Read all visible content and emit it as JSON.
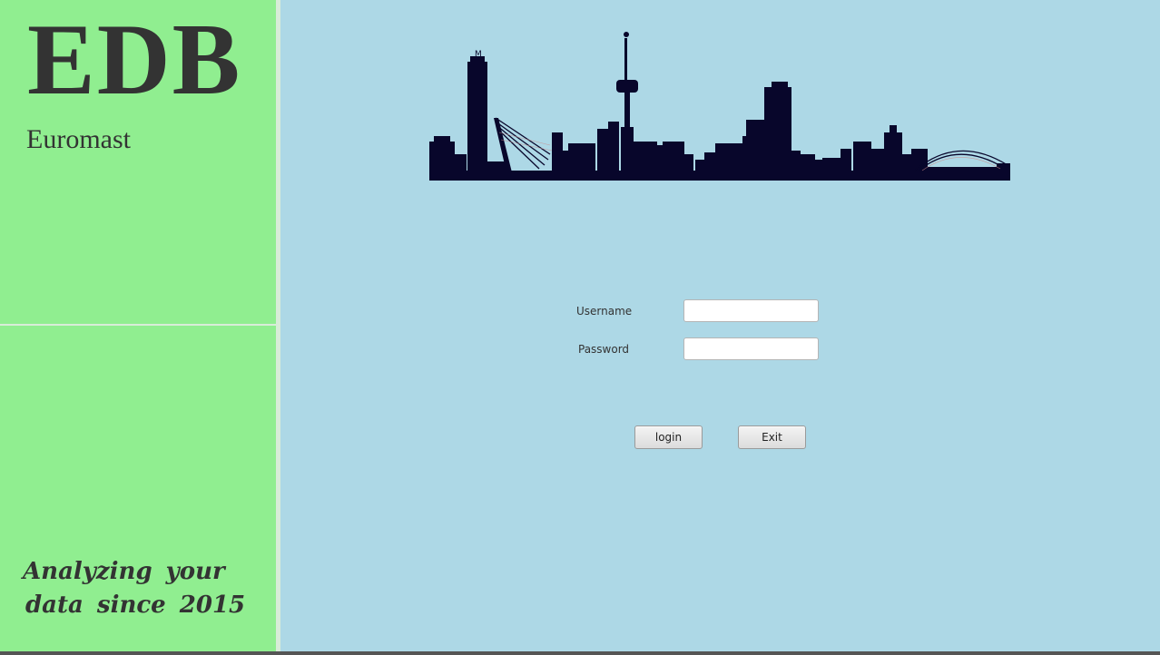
{
  "sidebar": {
    "title": "EDB",
    "subtitle": "Euromast",
    "tagline_line1": "Analyzing your",
    "tagline_line2": "data since 2015"
  },
  "skyline": {
    "icon": "rotterdam-skyline-icon",
    "marker_letter": "M",
    "color": "#08062b"
  },
  "login_form": {
    "username_label": "Username",
    "username_value": "",
    "password_label": "Password",
    "password_value": "",
    "login_button": "login",
    "exit_button": "Exit"
  },
  "colors": {
    "sidebar_background": "#90ee90",
    "main_background": "#add8e6",
    "text": "#333333"
  }
}
